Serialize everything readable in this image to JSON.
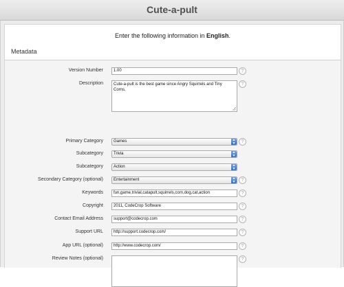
{
  "app": {
    "title": "Cute-a-pult"
  },
  "instruction": {
    "prefix": "Enter the following information in ",
    "language": "English",
    "suffix": "."
  },
  "section": {
    "title": "Metadata"
  },
  "icons": {
    "help": "question-mark-circle-icon",
    "dropdown": "chevron-updown-icon"
  },
  "colors": {
    "select_arrow": "#2f6fd3"
  },
  "form": {
    "version_number": {
      "label": "Version Number",
      "value": "1.00"
    },
    "description": {
      "label": "Description",
      "value": "Cute-a-pult is the best game since Angry Squirrels and Tiny Corns."
    },
    "primary_category": {
      "label": "Primary Category",
      "value": "Games"
    },
    "subcategory_1": {
      "label": "Subcategory",
      "value": "Trivia"
    },
    "subcategory_2": {
      "label": "Subcategory",
      "value": "Action"
    },
    "secondary_category": {
      "label": "Secondary Category (optional)",
      "value": "Entertainment"
    },
    "keywords": {
      "label": "Keywords",
      "value": "fun,game,trivial,catapult,squirrels,corn,dog,cat,action"
    },
    "copyright": {
      "label": "Copyright",
      "value": "2011, CodeCrop Software"
    },
    "contact_email": {
      "label": "Contact Email Address",
      "value": "support@codecrop.com"
    },
    "support_url": {
      "label": "Support URL",
      "value": "http://support.codecrop.com/"
    },
    "app_url": {
      "label": "App URL (optional)",
      "value": "http://www.codecrop.com/"
    },
    "review_notes": {
      "label": "Review Notes (optional)",
      "value": ""
    }
  }
}
